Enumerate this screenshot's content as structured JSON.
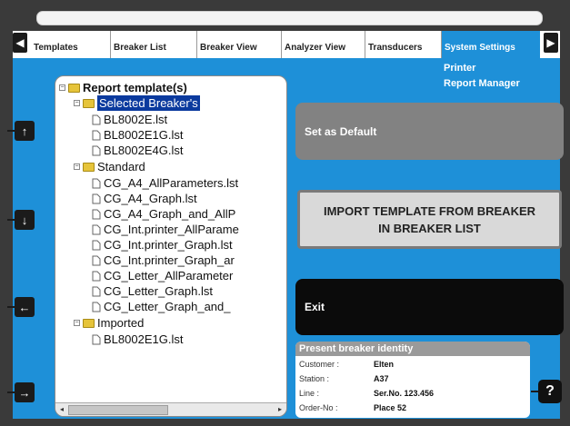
{
  "tabs": {
    "prev_arrow": "◀",
    "next_arrow": "▶",
    "items": [
      "Templates",
      "Breaker List",
      "Breaker View",
      "Analyzer View",
      "Transducers",
      "System Settings"
    ]
  },
  "submenu": {
    "items": [
      "Printer",
      "Report Manager"
    ]
  },
  "side_buttons": {
    "up": "↑",
    "down": "↓",
    "left": "←",
    "right": "→",
    "help": "?"
  },
  "tree": {
    "root": "Report template(s)",
    "selected_group": "Selected Breaker's",
    "selected_files": [
      "BL8002E.lst",
      "BL8002E1G.lst",
      "BL8002E4G.lst"
    ],
    "standard_group": "Standard",
    "standard_files": [
      "CG_A4_AllParameters.lst",
      "CG_A4_Graph.lst",
      "CG_A4_Graph_and_AllP",
      "CG_Int.printer_AllParame",
      "CG_Int.printer_Graph.lst",
      "CG_Int.printer_Graph_ar",
      "CG_Letter_AllParameter",
      "CG_Letter_Graph.lst",
      "CG_Letter_Graph_and_"
    ],
    "imported_group": "Imported",
    "imported_files": [
      "BL8002E1G.lst"
    ]
  },
  "buttons": {
    "set_default": "Set as Default",
    "import": "IMPORT TEMPLATE FROM BREAKER IN BREAKER LIST",
    "exit": "Exit"
  },
  "identity": {
    "title": "Present breaker identity",
    "rows": [
      {
        "label": "Customer :",
        "value": "Elten"
      },
      {
        "label": "Station :",
        "value": "A37"
      },
      {
        "label": "Line :",
        "value": "Ser.No. 123.456"
      },
      {
        "label": "Order-No :",
        "value": "Place 52"
      }
    ]
  },
  "colors": {
    "accent": "#1e90d8",
    "selection": "#0b3a9e",
    "frame": "#3a3a3a"
  }
}
